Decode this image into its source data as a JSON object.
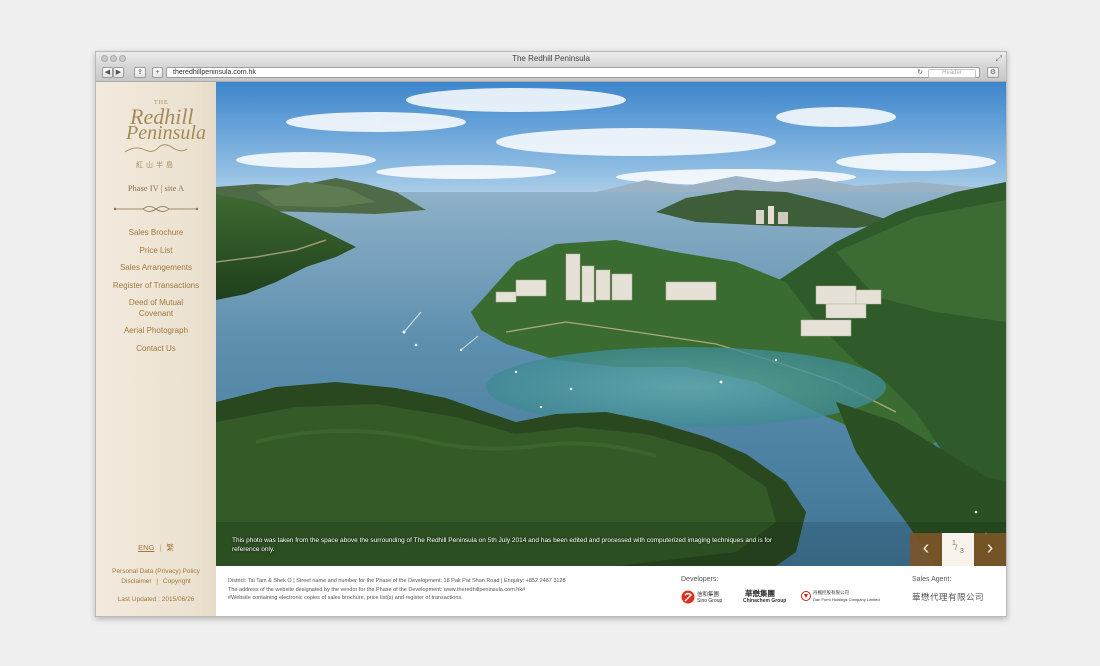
{
  "browser": {
    "title": "The Redhill Peninsula",
    "url": "theredhillpeninsula.com.hk",
    "reader_label": "Reader"
  },
  "logo": {
    "the": "THE",
    "word1": "Redhill",
    "word2": "Peninsula",
    "chinese": "紅山半島"
  },
  "sidebar": {
    "phase": "Phase IV | site A",
    "nav": [
      {
        "label": "Sales Brochure"
      },
      {
        "label": "Price List"
      },
      {
        "label": "Sales Arrangements"
      },
      {
        "label": "Register of Transactions"
      },
      {
        "label": "Deed of Mutual Covenant"
      },
      {
        "label": "Aerial Photograph"
      },
      {
        "label": "Contact Us"
      }
    ],
    "lang_eng": "ENG",
    "lang_chi": "繁",
    "privacy": "Personal Data (Privacy) Policy",
    "disclaimer": "Disclaimer",
    "copyright": "Copyright",
    "last_updated": "Last Updated : 2015/06/26"
  },
  "photo": {
    "caption": "This photo was taken from the space above the surrounding of The Redhill Peninsula on 5th July 2014 and has been edited and processed with computerized imaging techniques and is for reference only.",
    "page_current": "1",
    "page_total": "3"
  },
  "info": {
    "line1": "District: Tai Tam & Shek O | Street name and number for the Phase of the Development: 18 Pak Pat Shan Road | Enquiry: +852 2467 3128",
    "line2": "The address of the website designated by the vendor for the Phase of the Development: www.theredhillpeninsula.com.hk#",
    "line3": "#Website containing electronic copies of sales brochure, price list(s) and register of transactions.",
    "developers_label": "Developers:",
    "dev1_cn": "信和集團",
    "dev1_en": "Sino Group",
    "dev2_cn": "華懋集團",
    "dev2_en": "Chinachem Group",
    "dev3_cn": "丹楓控股有限公司",
    "dev3_en": "Dan Form Holdings Company Limited",
    "agent_label": "Sales Agent:",
    "agent_name": "華懋代理有限公司"
  },
  "colors": {
    "accent": "#a0793e",
    "pager": "#7d5428",
    "sidebar_bg": "#efe6d7"
  }
}
